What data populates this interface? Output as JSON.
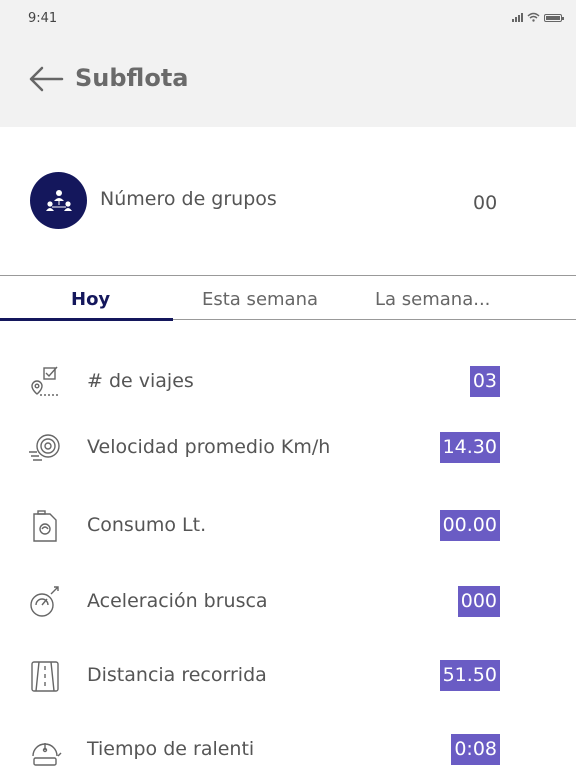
{
  "status_bar": {
    "time": "9:41"
  },
  "header": {
    "title": "Subflota"
  },
  "groups": {
    "label": "Número de grupos",
    "value": "00"
  },
  "tabs": [
    {
      "label": "Hoy",
      "active": true
    },
    {
      "label": "Esta semana",
      "active": false
    },
    {
      "label": "La semana...",
      "active": false
    }
  ],
  "metrics": [
    {
      "label": "# de viajes",
      "value": "03",
      "icon": "route-check-icon"
    },
    {
      "label": "Velocidad promedio Km/h",
      "value": "14.30",
      "icon": "speed-wheel-icon"
    },
    {
      "label": "Consumo Lt.",
      "value": "00.00",
      "icon": "fuel-can-icon"
    },
    {
      "label": "Aceleración brusca",
      "value": "000",
      "icon": "acceleration-gauge-icon"
    },
    {
      "label": "Distancia recorrida",
      "value": "51.50",
      "icon": "road-icon"
    },
    {
      "label": "Tiempo de ralenti",
      "value": "0:08",
      "icon": "idle-timer-icon"
    }
  ],
  "colors": {
    "header_bg": "#f2f2f2",
    "primary": "#14175c",
    "value_badge": "#6a5cc4"
  }
}
